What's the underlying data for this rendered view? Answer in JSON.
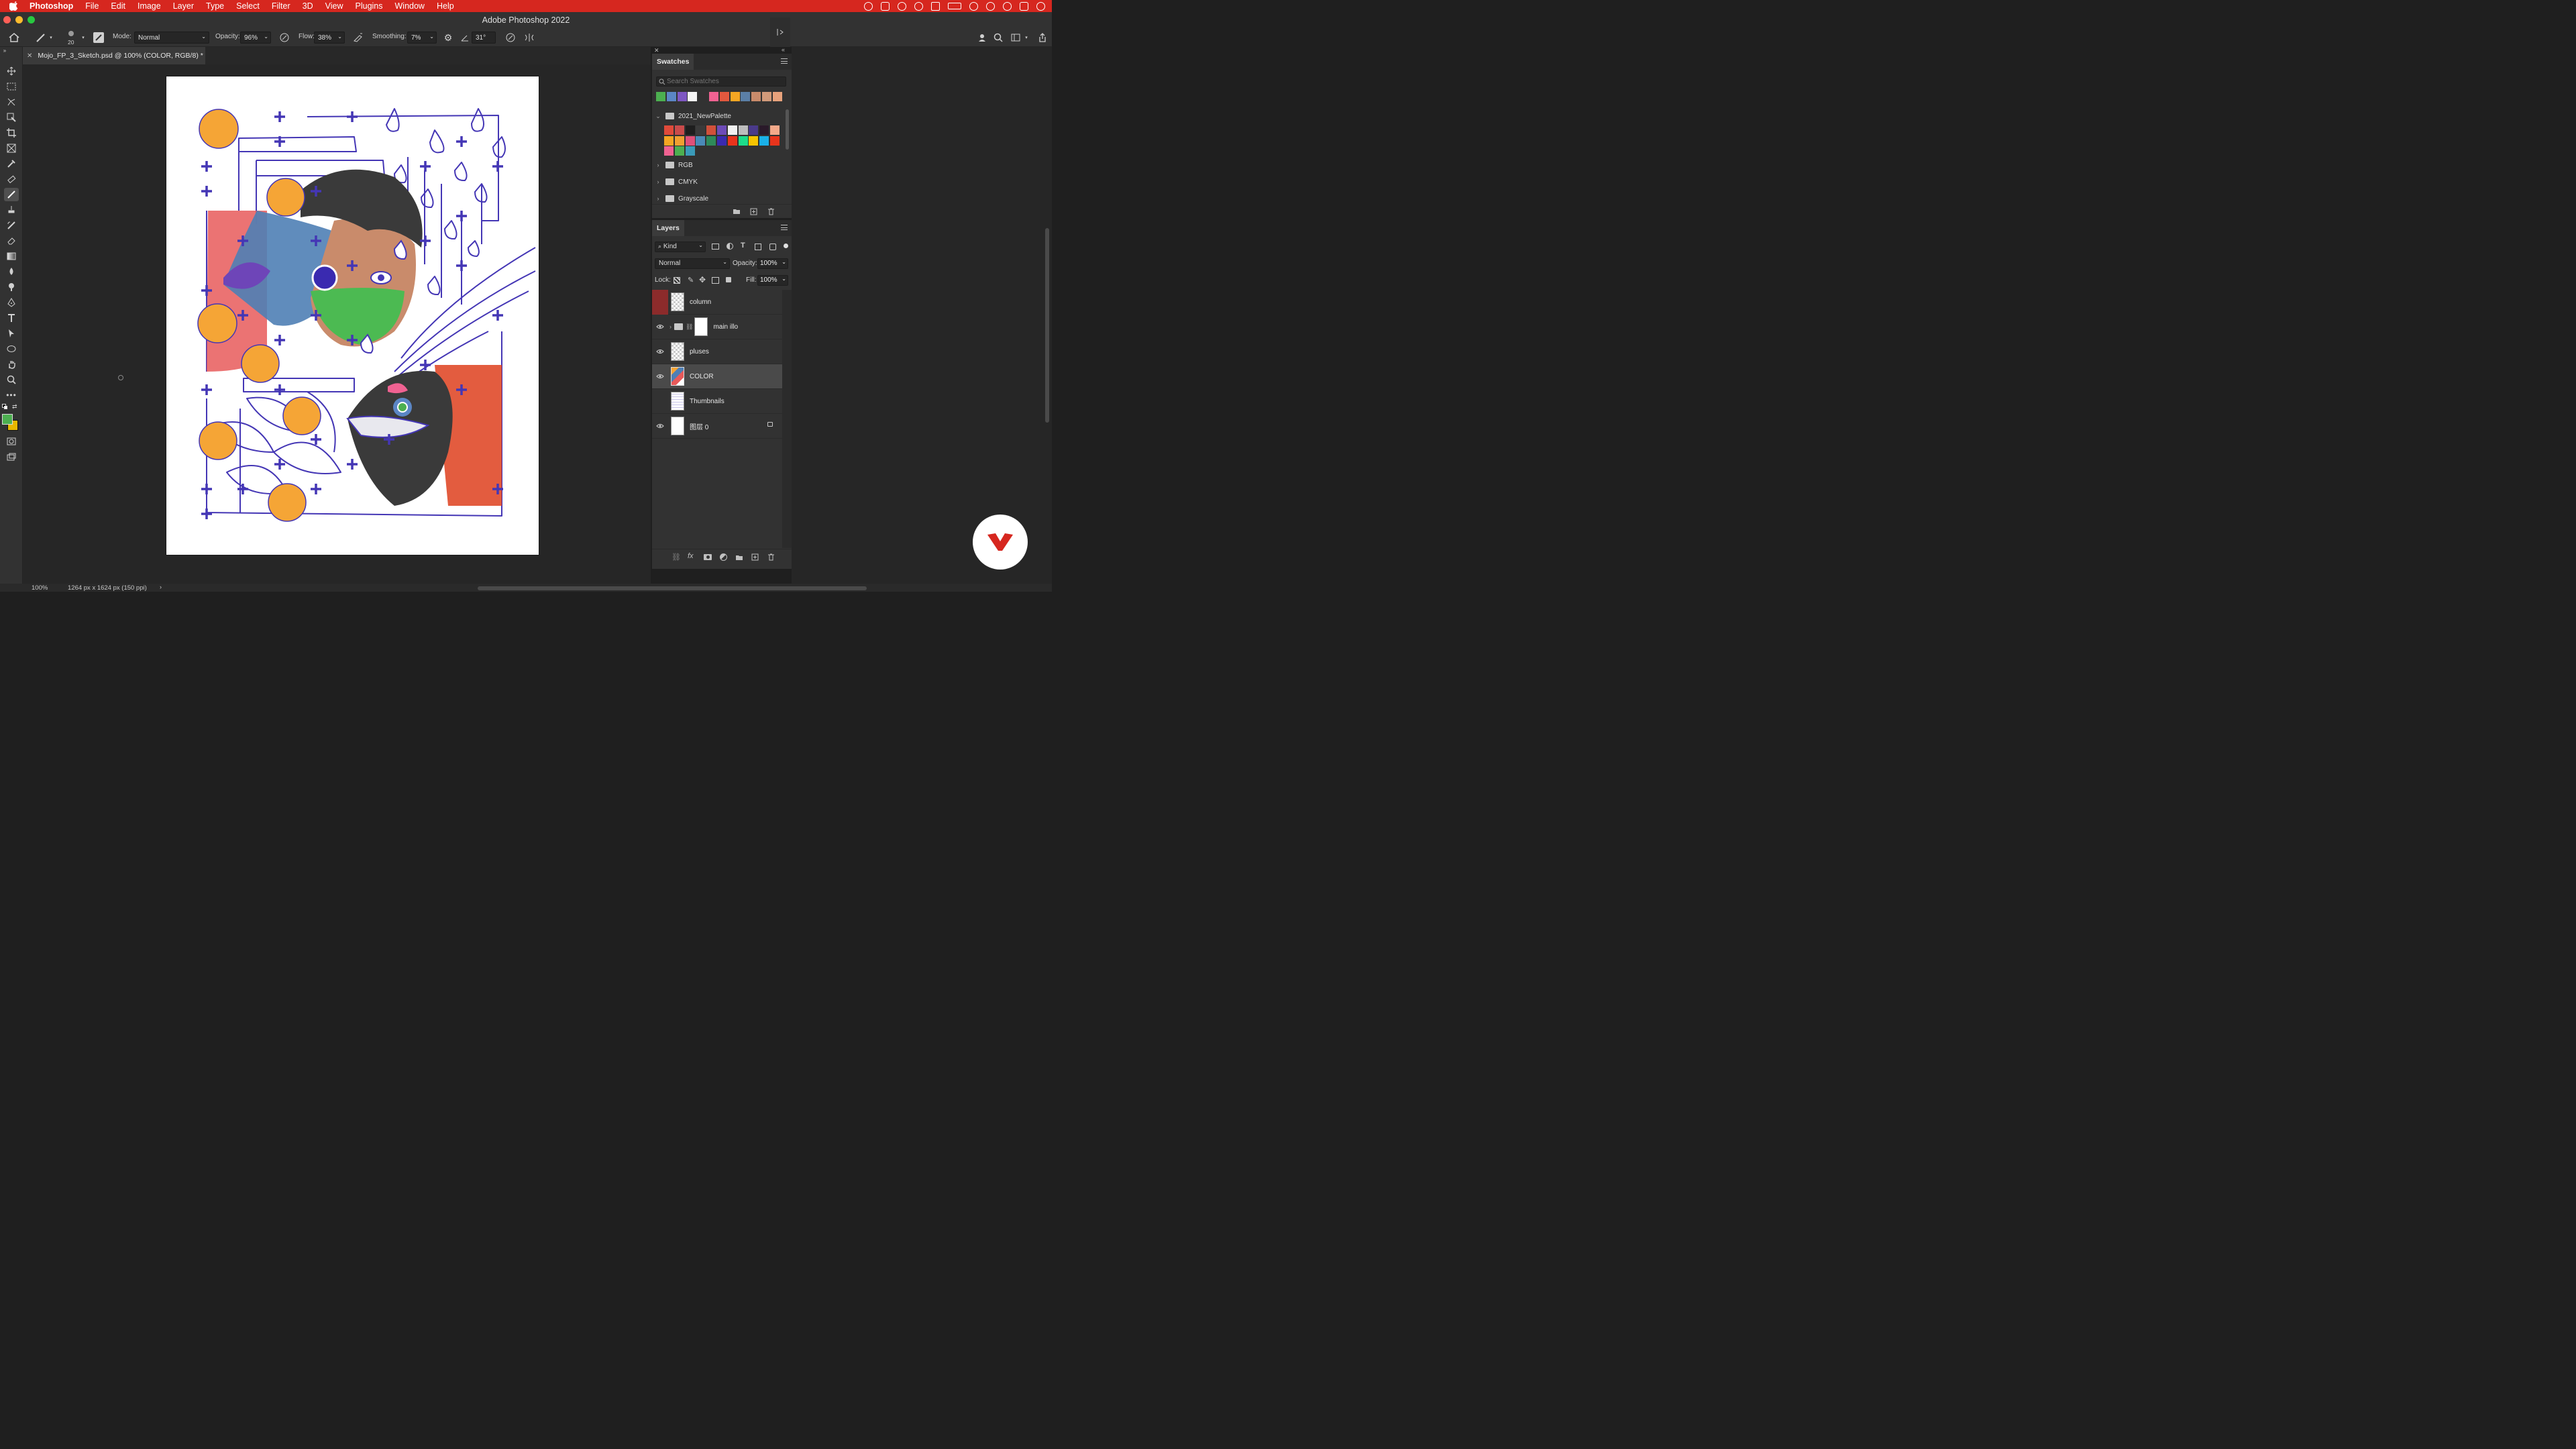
{
  "menubar": {
    "app_name": "Photoshop",
    "items": [
      "File",
      "Edit",
      "Image",
      "Layer",
      "Type",
      "Select",
      "Filter",
      "3D",
      "View",
      "Plugins",
      "Window",
      "Help"
    ]
  },
  "window": {
    "title": "Adobe Photoshop 2022"
  },
  "options_bar": {
    "brush_size": "20",
    "mode_label": "Mode:",
    "mode_value": "Normal",
    "opacity_label": "Opacity:",
    "opacity_value": "96%",
    "flow_label": "Flow:",
    "flow_value": "38%",
    "smoothing_label": "Smoothing:",
    "smoothing_value": "7%",
    "angle_value": "31°"
  },
  "document": {
    "tab_title": "Mojo_FP_3_Sketch.psd @ 100% (COLOR, RGB/8) *"
  },
  "tools": [
    "move-tool",
    "marquee-tool",
    "lasso-tool",
    "object-select-tool",
    "crop-tool",
    "frame-tool",
    "eyedropper-tool",
    "healing-tool",
    "brush-tool",
    "stamp-tool",
    "history-brush-tool",
    "eraser-tool",
    "gradient-tool",
    "blur-tool",
    "dodge-tool",
    "pen-tool",
    "type-tool",
    "path-select-tool",
    "ellipse-tool",
    "hand-tool",
    "zoom-tool",
    "more-tools"
  ],
  "colors": {
    "foreground": "#4caf50",
    "background": "#e6b800",
    "accent_red": "#d6271f"
  },
  "swatches_panel": {
    "tab_label": "Swatches",
    "search_placeholder": "Search Swatches",
    "recent_colors": [
      "#4caf50",
      "#5b86c5",
      "#7e57c2",
      "#f5f5f5",
      "#2f2f2f",
      "#f06292",
      "#e2583e",
      "#f5a623",
      "#5b7fa6",
      "#c98b6b",
      "#d19a7a",
      "#e8a27c"
    ],
    "groups": [
      {
        "name": "2021_NewPalette",
        "expanded": true,
        "colors": [
          "#e04a3a",
          "#c94b4b",
          "#1e1e1e",
          "#3a3a3a",
          "#d1503a",
          "#6d4bb8",
          "#f2f2f2",
          "#bdbdbd",
          "#4a3a8a",
          "#2a1a2a",
          "#f4a98a",
          "#f5a623",
          "#f0a030",
          "#e0507a",
          "#4a8ab8",
          "#2e8a5a",
          "#3a2ab0",
          "#e8341c",
          "#1ddc8a",
          "#f5c400",
          "#1ab0e8",
          "#e8341c",
          "#f06292",
          "#4caf50",
          "#3a9ab8"
        ]
      },
      {
        "name": "RGB",
        "expanded": false
      },
      {
        "name": "CMYK",
        "expanded": false
      },
      {
        "name": "Grayscale",
        "expanded": false
      }
    ]
  },
  "layers_panel": {
    "tab_label": "Layers",
    "filter_kind": "Kind",
    "blend_mode": "Normal",
    "opacity_label": "Opacity:",
    "opacity_value": "100%",
    "lock_label": "Lock:",
    "fill_label": "Fill:",
    "fill_value": "100%",
    "layers": [
      {
        "name": "column",
        "visible": false,
        "selected": false,
        "locked": false
      },
      {
        "name": "main illo",
        "visible": true,
        "selected": false,
        "locked": false
      },
      {
        "name": "pluses",
        "visible": true,
        "selected": false,
        "locked": false
      },
      {
        "name": "COLOR",
        "visible": true,
        "selected": true,
        "locked": false
      },
      {
        "name": "Thumbnails",
        "visible": false,
        "selected": false,
        "locked": false
      },
      {
        "name": "图层 0",
        "visible": true,
        "selected": false,
        "locked": true
      }
    ]
  },
  "statusbar": {
    "zoom": "100%",
    "doc_info": "1264 px x 1624 px (150 ppi)"
  }
}
